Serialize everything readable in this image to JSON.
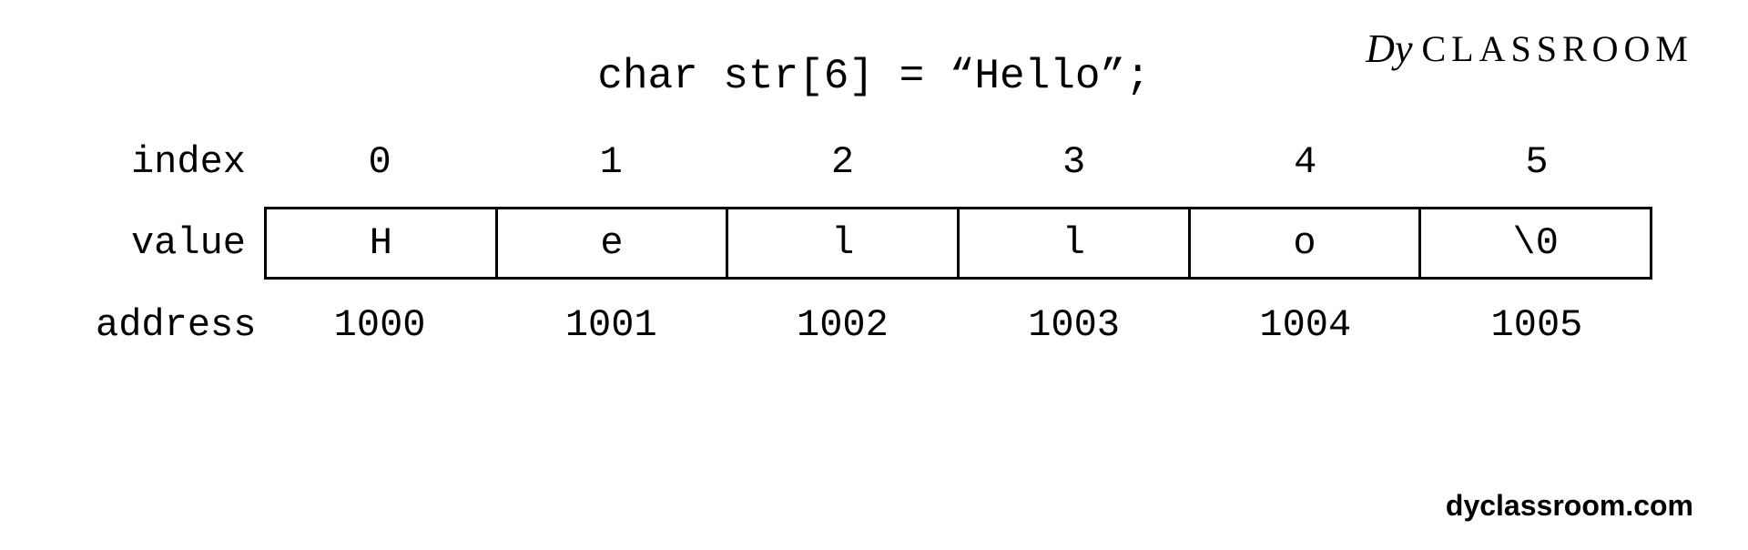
{
  "brand": {
    "logo": "Dy",
    "text": "CLASSROOM"
  },
  "declaration": "char str[6] = “Hello”;",
  "labels": {
    "index": "index",
    "value": "value",
    "address": "address"
  },
  "array": {
    "indices": [
      "0",
      "1",
      "2",
      "3",
      "4",
      "5"
    ],
    "values": [
      "H",
      "e",
      "l",
      "l",
      "o",
      "\\0"
    ],
    "addresses": [
      "1000",
      "1001",
      "1002",
      "1003",
      "1004",
      "1005"
    ]
  },
  "url": "dyclassroom.com"
}
